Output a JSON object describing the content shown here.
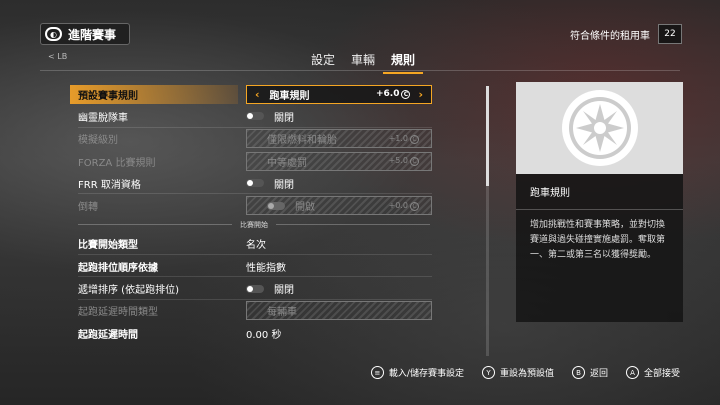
{
  "header": {
    "title": "進階賽事",
    "lb_label": "< LB",
    "eligible_label": "符合條件的租用車",
    "eligible_count": "22"
  },
  "tabs": [
    {
      "label": "設定",
      "active": false
    },
    {
      "label": "車輛",
      "active": false
    },
    {
      "label": "規則",
      "active": true
    }
  ],
  "settings": {
    "row0": {
      "label": "預設賽事規則",
      "value": "跑車規則",
      "extra": "+6.0",
      "credit": "C"
    },
    "row1": {
      "label": "幽靈脫隊車",
      "value": "關閉"
    },
    "row2": {
      "label": "模擬級別",
      "value": "僅限燃料和輪胎",
      "extra": "+1.0",
      "credit": "C"
    },
    "row3": {
      "label": "FORZA 比賽規則",
      "value": "中等處罰",
      "extra": "+5.0",
      "credit": "C"
    },
    "row4": {
      "label": "FRR 取消資格",
      "value": "關閉"
    },
    "row5": {
      "label": "倒轉",
      "value": "開啟",
      "extra": "+0.0",
      "credit": "C"
    },
    "section": "比賽開始",
    "row6": {
      "label": "比賽開始類型",
      "value": "名次"
    },
    "row7": {
      "label": "起跑排位順序依據",
      "value": "性能指數"
    },
    "row8": {
      "label": "遞增排序 (依起跑排位)",
      "value": "關閉"
    },
    "row9": {
      "label": "起跑延遲時間類型",
      "value": "每輛車"
    },
    "row10": {
      "label": "起跑延遲時間",
      "value": "0.00 秒"
    }
  },
  "info": {
    "title": "跑車規則",
    "description": "增加挑戰性和賽事策略，並對切換賽道與過失碰撞實施處罰。奪取第一、第二或第三名以獲得獎勵。"
  },
  "footer": {
    "load_save": {
      "glyph": "≡",
      "label": "載入/儲存賽事設定"
    },
    "reset": {
      "glyph": "Y",
      "label": "重設為預設值"
    },
    "back": {
      "glyph": "B",
      "label": "返回"
    },
    "accept": {
      "glyph": "A",
      "label": "全部接受"
    }
  },
  "colors": {
    "accent": "#f5a623"
  },
  "icons": {
    "wheel": "wheel-icon",
    "title": "forza-logo-icon"
  }
}
